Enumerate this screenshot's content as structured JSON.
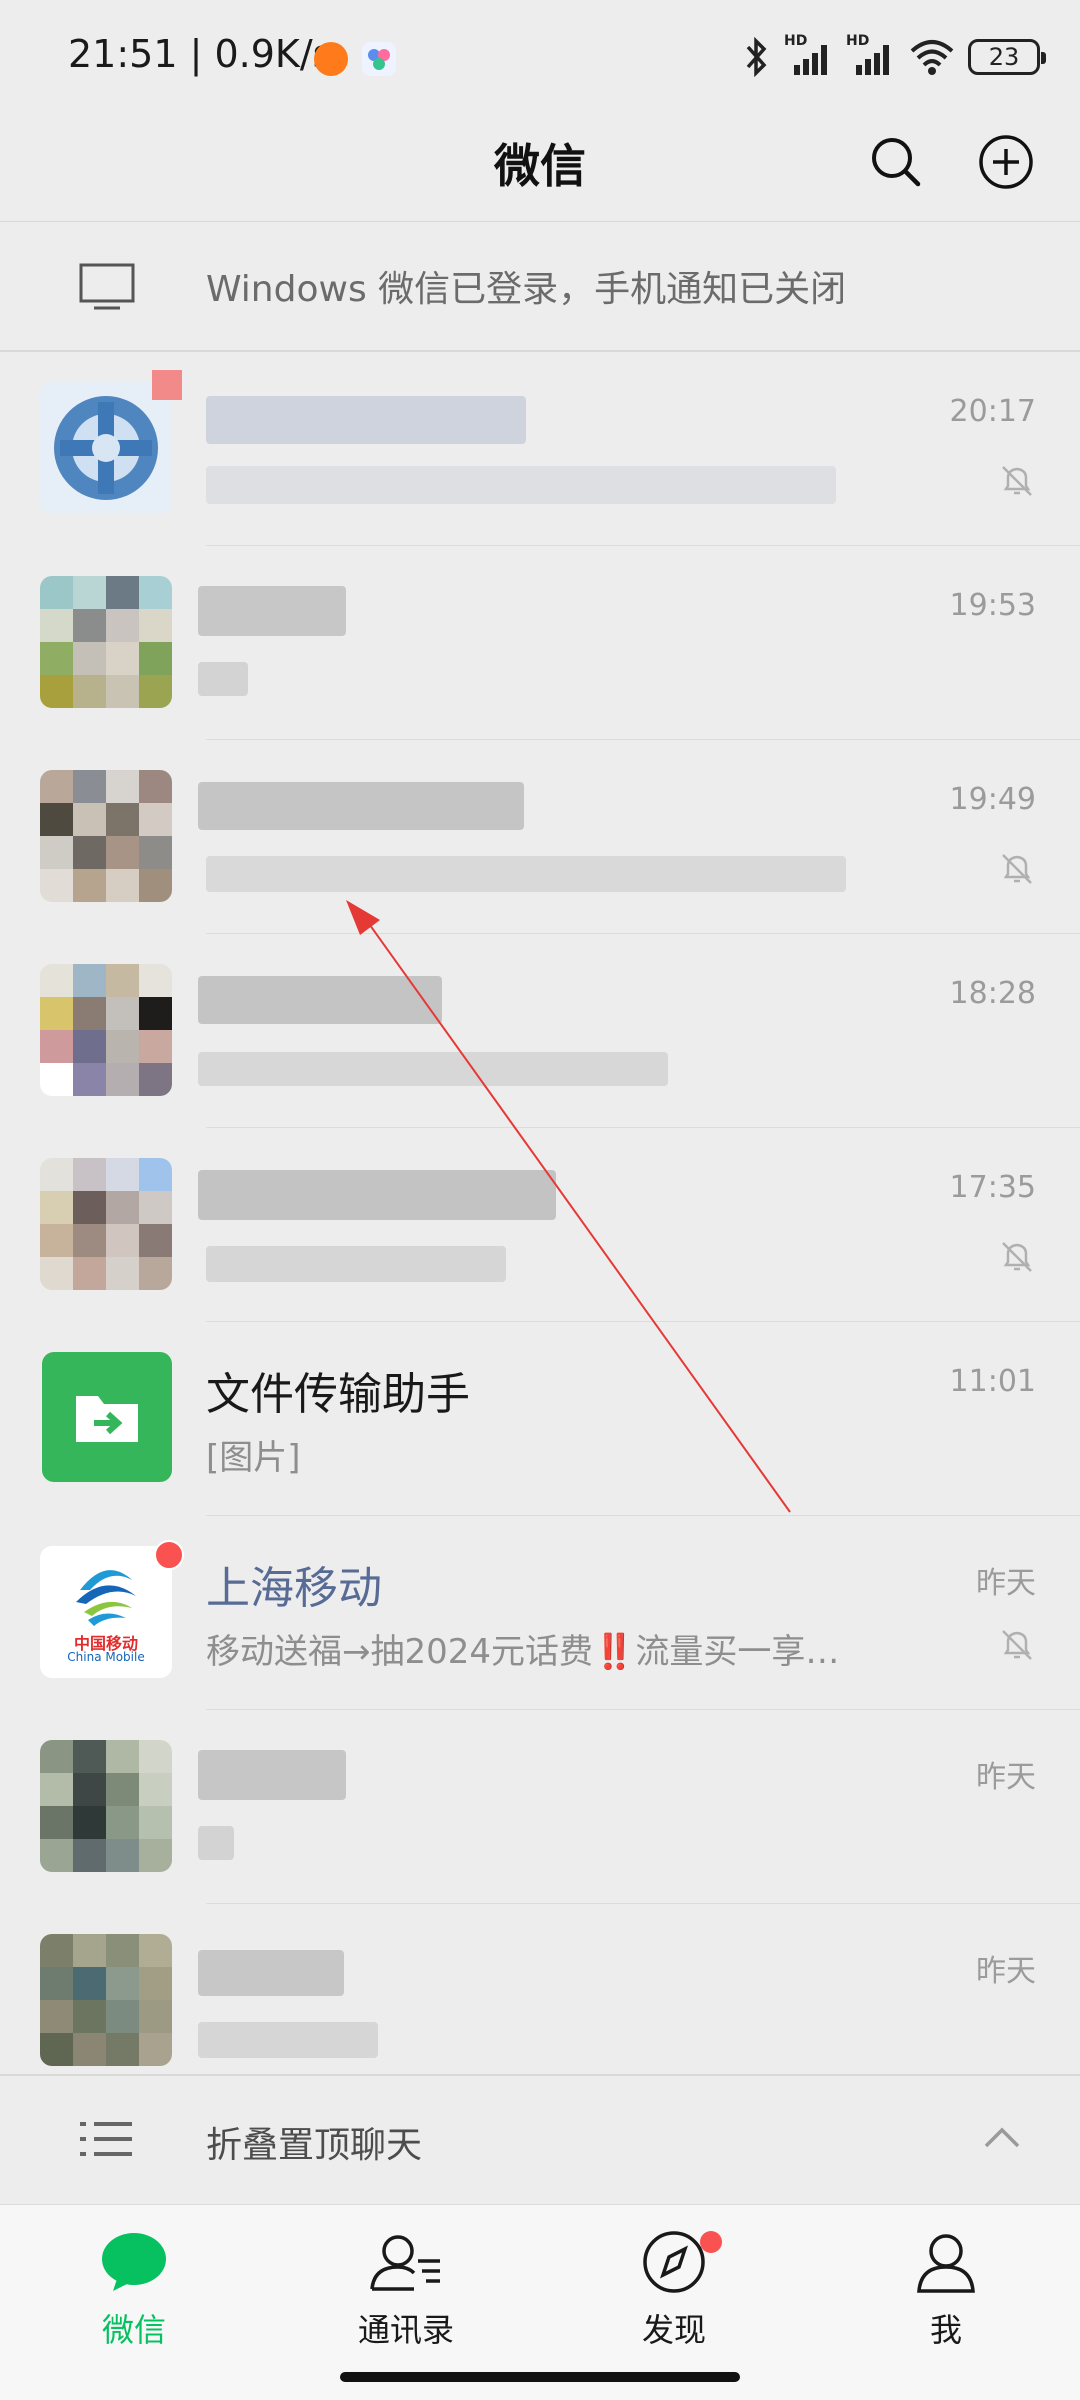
{
  "status_bar": {
    "time_speed": "21:51 | 0.9K/s",
    "battery": "23",
    "hd1": "HD",
    "hd2": "HD"
  },
  "header": {
    "title": "微信"
  },
  "login_banner": {
    "text": "Windows 微信已登录，手机通知已关闭"
  },
  "chats": [
    {
      "name": "",
      "preview": "",
      "time": "20:17",
      "muted": true,
      "blurred": true
    },
    {
      "name": "",
      "preview": "",
      "time": "19:53",
      "muted": false,
      "blurred": true
    },
    {
      "name": "",
      "preview": "",
      "time": "19:49",
      "muted": true,
      "blurred": true
    },
    {
      "name": "",
      "preview": "",
      "time": "18:28",
      "muted": false,
      "blurred": true
    },
    {
      "name": "",
      "preview": "",
      "time": "17:35",
      "muted": true,
      "blurred": true
    },
    {
      "name": "文件传输助手",
      "preview": "[图片]",
      "time": "11:01",
      "muted": false,
      "blurred": false
    },
    {
      "name": "上海移动",
      "preview": "移动送福→抽2024元话费‼️流量买一享…",
      "time": "昨天",
      "muted": true,
      "blurred": false,
      "unread_dot": true
    },
    {
      "name": "",
      "preview": "",
      "time": "昨天",
      "muted": false,
      "blurred": true
    },
    {
      "name": "",
      "preview": "",
      "time": "昨天",
      "muted": false,
      "blurred": true
    }
  ],
  "china_mobile_logo": {
    "cn": "中国移动",
    "en": "China Mobile"
  },
  "folded": {
    "label": "折叠置顶聊天"
  },
  "tabs": [
    {
      "label": "微信",
      "active": true
    },
    {
      "label": "通讯录",
      "active": false
    },
    {
      "label": "发现",
      "active": false,
      "dot": true
    },
    {
      "label": "我",
      "active": false
    }
  ],
  "colors": {
    "accent_green": "#07c160",
    "official_name": "#576b95",
    "badge_red": "#fa5151",
    "annotation_red": "#e53935"
  }
}
